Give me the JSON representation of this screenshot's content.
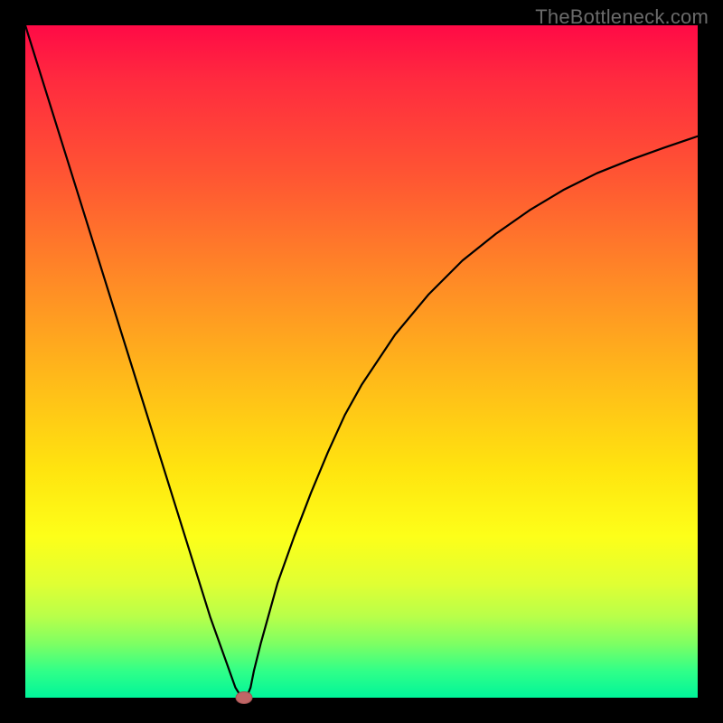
{
  "watermark": "TheBottleneck.com",
  "colors": {
    "frame": "#000000",
    "curve": "#000000",
    "dot_fill": "#c06666",
    "dot_border": "#a05050",
    "gradient_top": "#ff0a46",
    "gradient_bottom": "#00f59a"
  },
  "chart_data": {
    "type": "line",
    "title": "",
    "xlabel": "",
    "ylabel": "",
    "xlim": [
      0,
      100
    ],
    "ylim": [
      0,
      100
    ],
    "grid": false,
    "legend": false,
    "note": "Axis values are relative percentages estimated from the unlabeled plot area (0 = left/bottom edge, 100 = right/top edge).",
    "series": [
      {
        "name": "curve",
        "x": [
          0.0,
          2.5,
          5.0,
          7.5,
          10.0,
          12.5,
          15.0,
          17.5,
          20.0,
          22.5,
          25.0,
          27.5,
          30.0,
          31.25,
          32.0,
          32.5,
          33.0,
          33.5,
          34.0,
          35.0,
          37.5,
          40.0,
          42.5,
          45.0,
          47.5,
          50.0,
          55.0,
          60.0,
          65.0,
          70.0,
          75.0,
          80.0,
          85.0,
          90.0,
          95.0,
          100.0
        ],
        "y": [
          100.0,
          92.0,
          84.0,
          76.0,
          68.0,
          60.0,
          52.0,
          44.0,
          36.0,
          28.0,
          20.0,
          12.0,
          5.0,
          1.5,
          0.3,
          0.0,
          0.3,
          1.5,
          4.0,
          8.0,
          17.0,
          24.0,
          30.5,
          36.5,
          42.0,
          46.5,
          54.0,
          60.0,
          65.0,
          69.0,
          72.5,
          75.5,
          78.0,
          80.0,
          81.8,
          83.5
        ]
      }
    ],
    "marker": {
      "x": 32.5,
      "y": 0.0
    }
  }
}
